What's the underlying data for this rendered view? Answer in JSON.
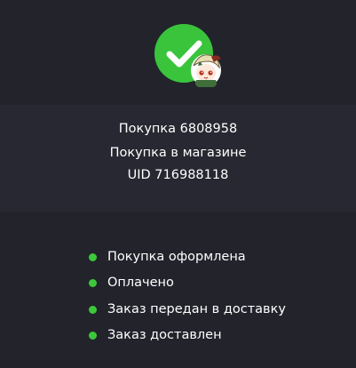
{
  "order": {
    "status_icon": "check-icon",
    "purchase_number": "Покупка 6808958",
    "purchase_type": "Покупка в магазине",
    "uid": "UID 716988118"
  },
  "steps": [
    {
      "label": "Покупка оформлена",
      "done": true
    },
    {
      "label": "Оплачено",
      "done": true
    },
    {
      "label": "Заказ передан в доставку",
      "done": true
    },
    {
      "label": "Заказ доставлен",
      "done": true
    }
  ],
  "colors": {
    "background": "#22232b",
    "panel": "#272831",
    "success": "#39c43c",
    "text": "#ffffff"
  }
}
